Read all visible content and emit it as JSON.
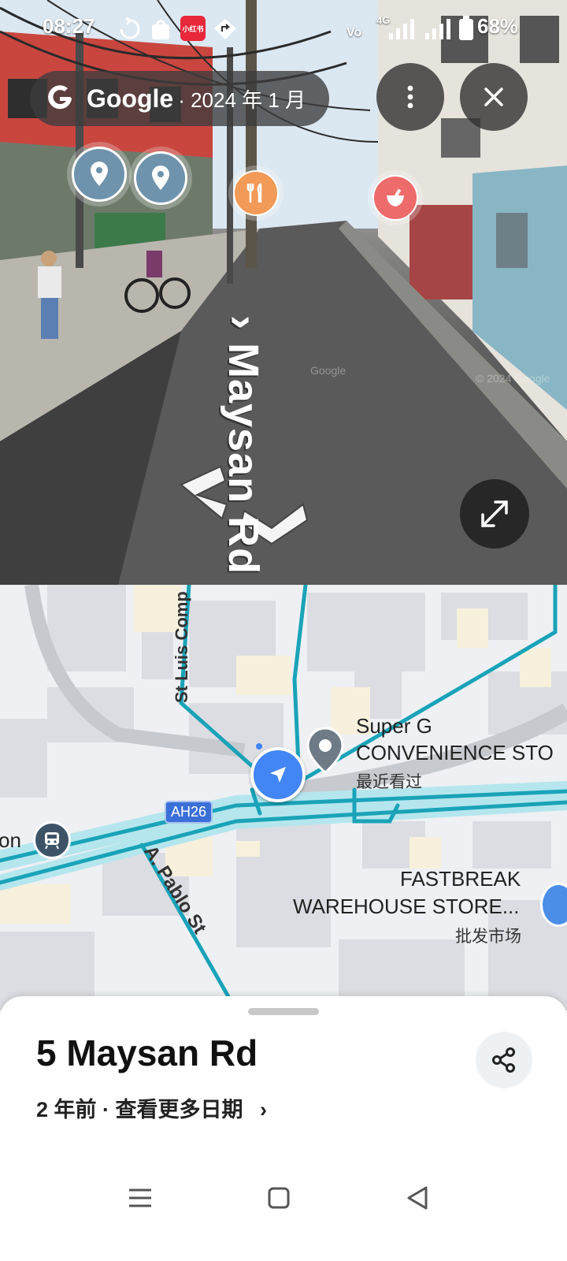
{
  "status_bar": {
    "time": "08:27",
    "battery": "68%",
    "xiaohongshu_badge": "小红书",
    "network": "4G",
    "icons": [
      "sync-icon",
      "shop-icon",
      "xiaohongshu-icon",
      "location-arrow-icon",
      "volte-icon",
      "signal-4g-icon",
      "signal-icon",
      "battery-icon"
    ]
  },
  "streetview": {
    "brand": "Google",
    "date": "· 2024 年 1 月",
    "street_label": "Maysan Rd",
    "copyright": "© 2024 Google",
    "watermark": "Google",
    "poi_icons": [
      "place-pin-icon",
      "place-pin-icon",
      "restaurant-icon",
      "pharmacy-icon"
    ],
    "colors": {
      "pin": "#6f93ad",
      "restaurant": "#f29a57",
      "pharmacy": "#ee6b6b"
    }
  },
  "map": {
    "road_labels": {
      "st_luis": "St Luis Comp",
      "pablo": "A. Pablo St",
      "ah26": "AH26"
    },
    "places": [
      {
        "name_line1": "Super G",
        "name_line2": "CONVENIENCE STO",
        "note": "最近看过"
      },
      {
        "name_line1": "FASTBREAK",
        "name_line2": "WAREHOUSE STORE...",
        "note": "批发市场"
      }
    ],
    "cutoff_label": "on",
    "colors": {
      "route": "#1aa3b8",
      "location": "#4285f4",
      "badge": "#3b6fd8"
    }
  },
  "sheet": {
    "title": "5 Maysan Rd",
    "subtitle": "2 年前 · 查看更多日期",
    "chevron": "›"
  },
  "nav": {
    "icons": [
      "menu-icon",
      "home-icon",
      "back-icon"
    ]
  }
}
